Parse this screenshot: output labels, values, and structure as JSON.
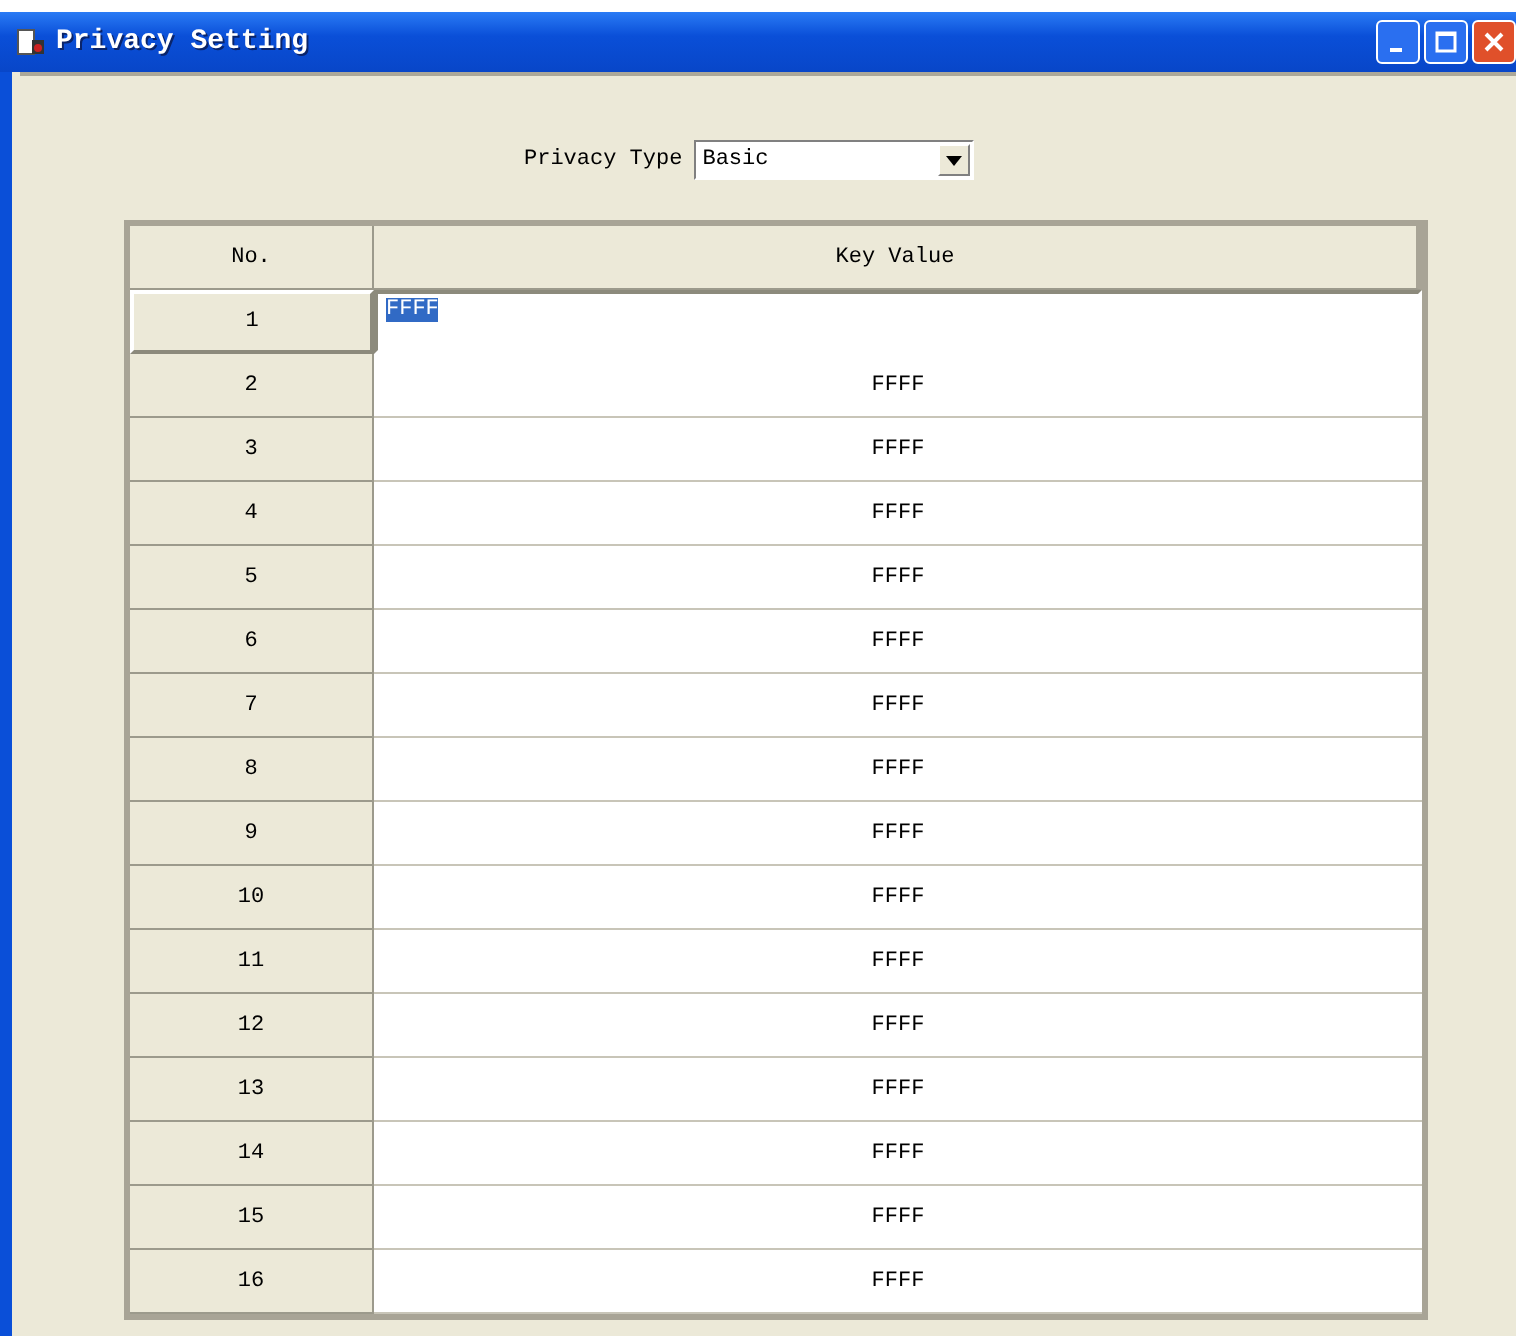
{
  "window": {
    "title": "Privacy Setting"
  },
  "privacy_type": {
    "label": "Privacy Type",
    "value": "Basic"
  },
  "table": {
    "columns": [
      "No.",
      "Key Value"
    ],
    "rows": [
      {
        "no": "1",
        "key_value": "FFFF",
        "selected": true
      },
      {
        "no": "2",
        "key_value": "FFFF",
        "selected": false
      },
      {
        "no": "3",
        "key_value": "FFFF",
        "selected": false
      },
      {
        "no": "4",
        "key_value": "FFFF",
        "selected": false
      },
      {
        "no": "5",
        "key_value": "FFFF",
        "selected": false
      },
      {
        "no": "6",
        "key_value": "FFFF",
        "selected": false
      },
      {
        "no": "7",
        "key_value": "FFFF",
        "selected": false
      },
      {
        "no": "8",
        "key_value": "FFFF",
        "selected": false
      },
      {
        "no": "9",
        "key_value": "FFFF",
        "selected": false
      },
      {
        "no": "10",
        "key_value": "FFFF",
        "selected": false
      },
      {
        "no": "11",
        "key_value": "FFFF",
        "selected": false
      },
      {
        "no": "12",
        "key_value": "FFFF",
        "selected": false
      },
      {
        "no": "13",
        "key_value": "FFFF",
        "selected": false
      },
      {
        "no": "14",
        "key_value": "FFFF",
        "selected": false
      },
      {
        "no": "15",
        "key_value": "FFFF",
        "selected": false
      },
      {
        "no": "16",
        "key_value": "FFFF",
        "selected": false
      }
    ]
  }
}
